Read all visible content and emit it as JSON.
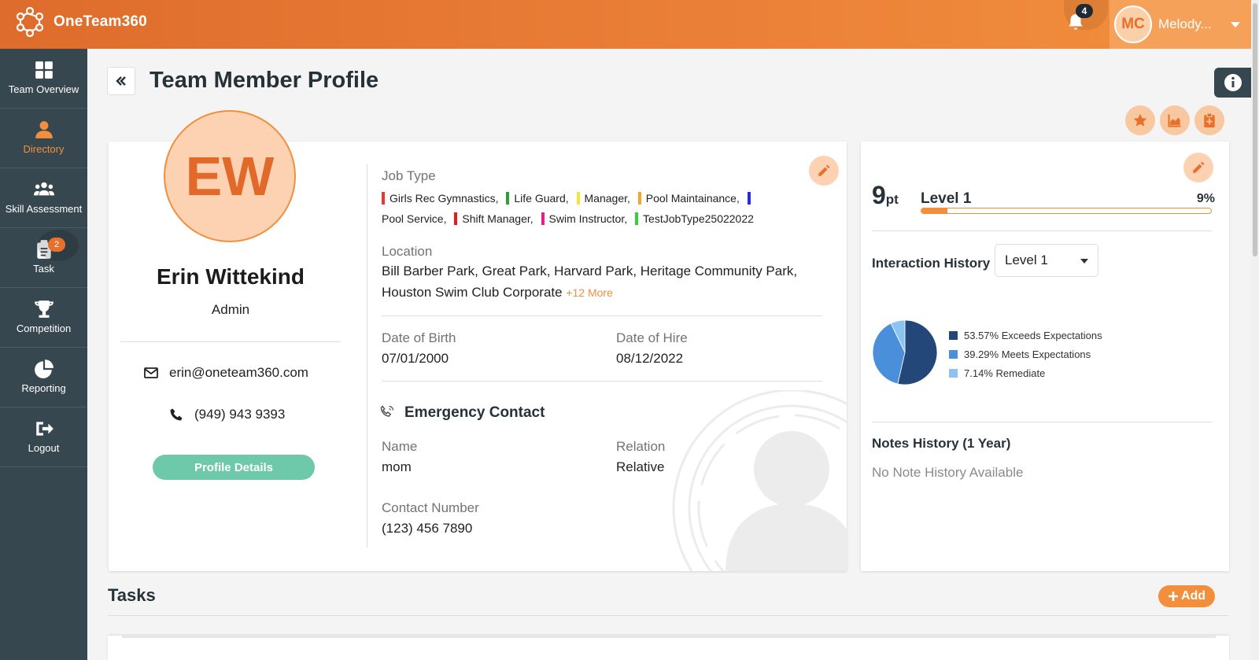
{
  "app": {
    "name": "OneTeam360"
  },
  "header": {
    "notification_count": "4",
    "user_initials": "MC",
    "user_name": "Melody..."
  },
  "sidebar": {
    "items": [
      {
        "label": "Team Overview",
        "icon": "grid-icon",
        "active": false
      },
      {
        "label": "Directory",
        "icon": "user-icon",
        "active": true
      },
      {
        "label": "Skill Assessment",
        "icon": "users-icon",
        "active": false
      },
      {
        "label": "Task",
        "icon": "clipboard-icon",
        "active": false,
        "badge": "2"
      },
      {
        "label": "Competition",
        "icon": "trophy-icon",
        "active": false
      },
      {
        "label": "Reporting",
        "icon": "pie-chart-icon",
        "active": false
      },
      {
        "label": "Logout",
        "icon": "logout-icon",
        "active": false
      }
    ]
  },
  "page": {
    "title": "Team Member Profile"
  },
  "profile": {
    "initials": "EW",
    "name": "Erin Wittekind",
    "role": "Admin",
    "email": "erin@oneteam360.com",
    "phone": "(949) 943 9393",
    "details_button": "Profile Details",
    "job_type_label": "Job Type",
    "job_types": [
      {
        "name": "Girls Rec Gymnastics,",
        "color": "#e53935"
      },
      {
        "name": "Life Guard,",
        "color": "#2e9e3a"
      },
      {
        "name": "Manager,",
        "color": "#f5e63b"
      },
      {
        "name": "Pool Maintainance,",
        "color": "#f5a623"
      },
      {
        "name": "Pool Service,",
        "color": "#2b2bd6"
      },
      {
        "name": "Shift Manager,",
        "color": "#e01e1e"
      },
      {
        "name": "Swim Instructor,",
        "color": "#e91e8c"
      },
      {
        "name": "TestJobType25022022",
        "color": "#33d133"
      }
    ],
    "location_label": "Location",
    "location_line1": "Bill Barber Park, Great Park, Harvard Park, Heritage Community Park,",
    "location_line2": "Houston Swim Club Corporate",
    "location_more": "+12 More",
    "dob_label": "Date of Birth",
    "dob": "07/01/2000",
    "hire_label": "Date of Hire",
    "hire": "08/12/2022",
    "emergency_title": "Emergency Contact",
    "ec_name_label": "Name",
    "ec_name": "mom",
    "ec_relation_label": "Relation",
    "ec_relation": "Relative",
    "ec_number_label": "Contact Number",
    "ec_number": "(123) 456 7890"
  },
  "score": {
    "points": "9",
    "points_unit": "pt",
    "level": "Level 1",
    "percent_label": "9%",
    "progress": 0.09,
    "interaction_label": "Interaction History",
    "level_select": "Level 1",
    "notes_label": "Notes History (1 Year)",
    "notes_empty": "No Note History Available"
  },
  "chart_data": {
    "type": "pie",
    "slices": [
      {
        "label": "53.57% Exceeds Expectations",
        "value": 53.57,
        "color": "#24477a"
      },
      {
        "label": "39.29% Meets Expectations",
        "value": 39.29,
        "color": "#4a8fd9"
      },
      {
        "label": "7.14% Remediate",
        "value": 7.14,
        "color": "#8dc3f2"
      }
    ]
  },
  "tasks": {
    "title": "Tasks",
    "add_label": "Add"
  },
  "colors": {
    "accent": "#f28f3d",
    "sidebar": "#37474f",
    "success": "#6ec9aa"
  }
}
